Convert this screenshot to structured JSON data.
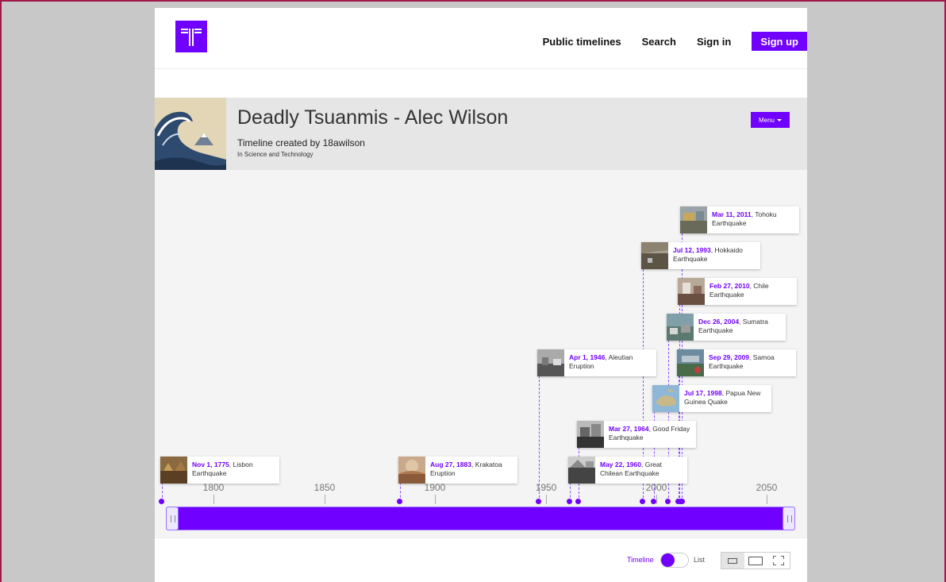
{
  "nav": {
    "public_timelines": "Public timelines",
    "search": "Search",
    "sign_in": "Sign in",
    "sign_up": "Sign up"
  },
  "timeline": {
    "title": "Deadly Tsuanmis - Alec Wilson",
    "creator": "Timeline created by 18awilson",
    "category": "In Science and Technology",
    "menu_label": "Menu"
  },
  "axis": {
    "labels": [
      "1800",
      "1850",
      "1900",
      "1950",
      "2000",
      "2050"
    ]
  },
  "events": [
    {
      "date": "Nov 1, 1775",
      "title": ", Lisbon Earthquake",
      "thumb": "painting-thumb"
    },
    {
      "date": "Aug 27, 1883",
      "title": ", Krakatoa Eruption",
      "thumb": "painting-thumb"
    },
    {
      "date": "Apr 1, 1946",
      "title": ", Aleutian Eruption",
      "thumb": "photo-thumb"
    },
    {
      "date": "May 22, 1960",
      "title": ", Great Chilean Earthquake",
      "thumb": "photo-thumb"
    },
    {
      "date": "Mar 27, 1964",
      "title": ", Good Friday Earthquake",
      "thumb": "photo-thumb"
    },
    {
      "date": "Jul 17, 1998",
      "title": ", Papua New Guinea Quake",
      "thumb": "map-thumb"
    },
    {
      "date": "Sep 29, 2009",
      "title": ", Samoa Earthquake",
      "thumb": "photo-thumb"
    },
    {
      "date": "Dec 26, 2004",
      "title": ", Sumatra Earthquake",
      "thumb": "photo-thumb"
    },
    {
      "date": "Feb 27, 2010",
      "title": ", Chile Earthquake",
      "thumb": "photo-thumb"
    },
    {
      "date": "Jul 12, 1993",
      "title": ", Hokkaido Earthquake",
      "thumb": "photo-thumb"
    },
    {
      "date": "Mar 11, 2011",
      "title": ", Tohoku Earthquake",
      "thumb": "photo-thumb"
    }
  ],
  "view": {
    "timeline_label": "Timeline",
    "list_label": "List",
    "mode": "Timeline"
  },
  "colors": {
    "accent": "#7000ff",
    "frame": "#a0184a"
  }
}
